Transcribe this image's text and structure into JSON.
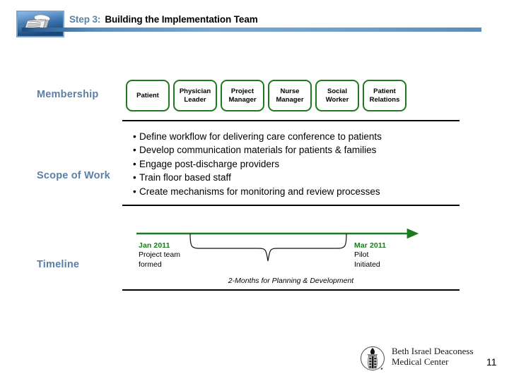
{
  "slide": {
    "title_step": "Step 3:",
    "title_main": "Building the Implementation Team",
    "title_icon_name": "documents-stack-icon",
    "page_number": "11",
    "accent_blue": "#5a82a8",
    "accent_green": "#1e7a1e",
    "label_blue": "#5c7fa6"
  },
  "rows": {
    "membership": {
      "label": "Membership"
    },
    "scope": {
      "label": "Scope of Work"
    },
    "timeline": {
      "label": "Timeline"
    }
  },
  "membership": {
    "boxes": [
      {
        "label": "Patient"
      },
      {
        "label": "Physician\nLeader"
      },
      {
        "label": "Project\nManager"
      },
      {
        "label": "Nurse\nManager"
      },
      {
        "label": "Social\nWorker"
      },
      {
        "label": "Patient\nRelations"
      }
    ]
  },
  "scope": {
    "bullet_char": "•",
    "items": [
      "Define workflow for delivering care conference to patients",
      "Develop communication materials for patients & families",
      "Engage post-discharge providers",
      "Train floor based staff",
      "Create mechanisms for monitoring and review processes"
    ]
  },
  "timeline": {
    "start": {
      "date": "Jan 2011",
      "desc": "Project team\nformed"
    },
    "end": {
      "date": "Mar 2011",
      "desc": "Pilot\nInitiated"
    },
    "brace_caption": "2-Months for Planning & Development"
  },
  "footer": {
    "org_name": "Beth Israel Deaconess\nMedical Center",
    "logo_name": "bidmc-seal-logo"
  }
}
